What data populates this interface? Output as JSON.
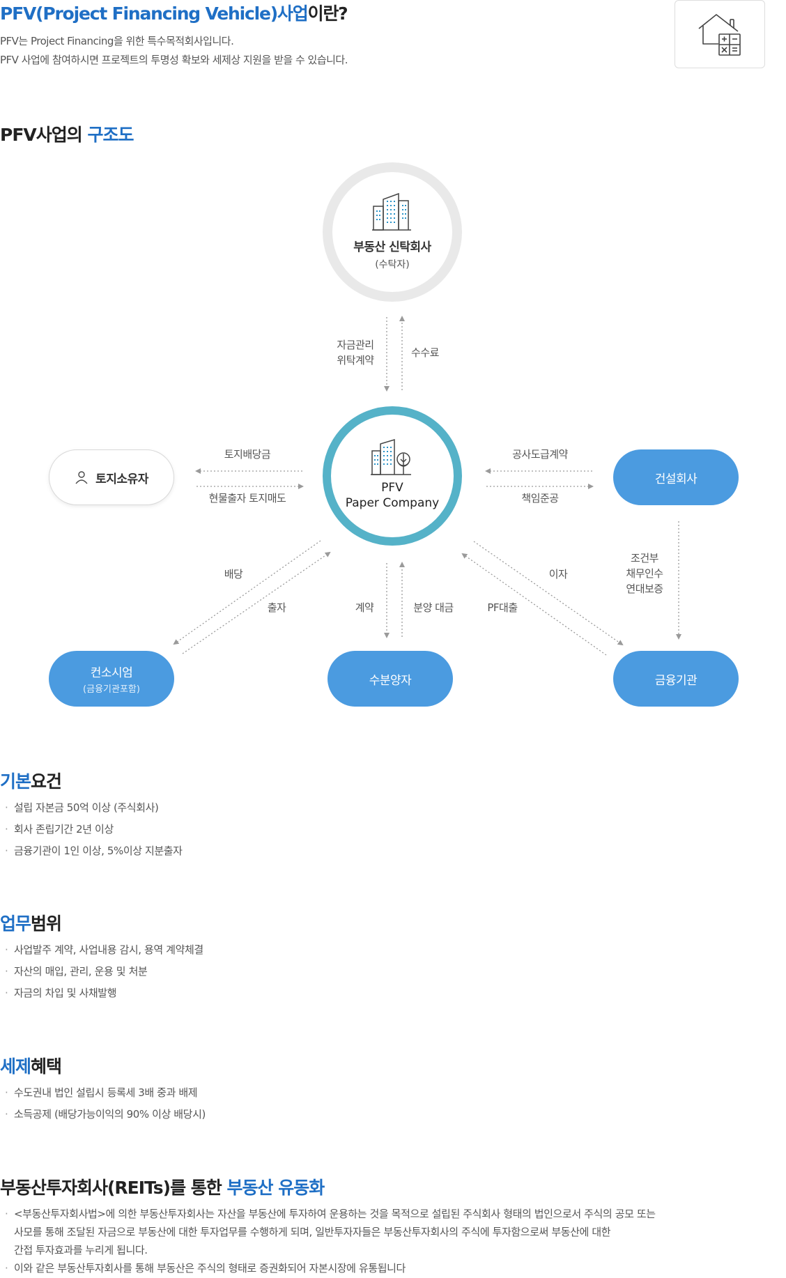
{
  "hero": {
    "title_blue": "PFV(Project Financing Vehicle)사업",
    "title_rest": "이란?",
    "desc_line1": "PFV는 Project Financing을 위한 특수목적회사입니다.",
    "desc_line2": "PFV 사업에 참여하시면 프로젝트의 투명성 확보와 세제상 지원을 받을 수 있습니다.",
    "icon": "house-calculator-icon"
  },
  "structure": {
    "title_black": "PFV사업의 ",
    "title_blue": "구조도"
  },
  "diagram": {
    "trust": {
      "name": "부동산 신탁회사",
      "sub": "(수탁자)"
    },
    "pfv": {
      "line1": "PFV",
      "line2": "Paper Company"
    },
    "landowner": "토지소유자",
    "construction": "건설회사",
    "consortium": {
      "name": "컨소시엄",
      "sub": "(금융기관포함)"
    },
    "buyer": "수분양자",
    "finance": "금융기관",
    "labels": {
      "fund_mgmt": [
        "자금관리",
        "위탁계약"
      ],
      "fee": "수수료",
      "land_dividend": "토지배당금",
      "in_kind": "현물출자 토지매도",
      "construction_contract": "공사도급계약",
      "completion": "책임준공",
      "dividend": "배당",
      "investment": "출자",
      "contract": "계약",
      "sale_payment": "분양 대금",
      "pf_loan": "PF대출",
      "interest": "이자",
      "conditional": [
        "조건부",
        "채무인수",
        "연대보증"
      ]
    }
  },
  "requirements": {
    "title_blue": "기본",
    "title_black": "요건",
    "items": [
      "설립 자본금 50억 이상 (주식회사)",
      "회사 존립기간 2년 이상",
      "금융기관이 1인 이상, 5%이상 지분출자"
    ]
  },
  "scope": {
    "title_blue": "업무",
    "title_black": "범위",
    "items": [
      "사업발주 계약, 사업내용 감시, 용역 계약체결",
      "자산의 매입, 관리, 운용 및 처분",
      "자금의 차입 및 사채발행"
    ]
  },
  "tax": {
    "title_blue": "세제",
    "title_black": "혜택",
    "items": [
      "수도권내 법인 설립시 등록세 3배 중과 배제",
      "소득공제 (배당가능이익의 90% 이상 배당시)"
    ]
  },
  "reits": {
    "title_black": "부동산투자회사(REITs)를 통한 ",
    "title_blue": "부동산 유동화",
    "item1_line1": "<부동산투자회사법>에 의한 부동산투자회사는 자산을 부동산에 투자하여 운용하는 것을 목적으로 설립된 주식회사 형태의 법인으로서 주식의 공모 또는",
    "item1_line2": "사모를 통해 조달된 자금으로 부동산에 대한 투자업무를 수행하게 되며, 일반투자자들은 부동산투자회사의 주식에 투자함으로써 부동산에 대한",
    "item1_line3": "간접 투자효과를 누리게 됩니다.",
    "item2": "이와 같은 부동산투자회사를 통해 부동산은 주식의 형태로 증권화되어 자본시장에 유통됩니다"
  },
  "colors": {
    "accent": "#1f6fc5",
    "node_blue": "#4b9be0",
    "pfv_ring": "#55b2c8",
    "trust_ring": "#e9e9e9"
  }
}
